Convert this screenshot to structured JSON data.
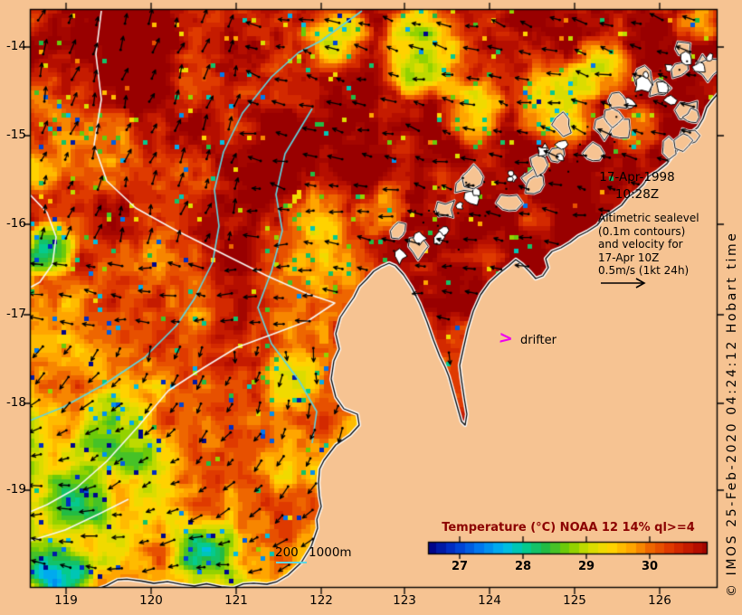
{
  "map": {
    "date_label": "17-Apr-1998",
    "time_label": "10:28Z",
    "annotation_lines": [
      "Altimetric sealevel",
      "(0.1m contours)",
      "and velocity for",
      "17-Apr 10Z",
      "0.5m/s (1kt 24h)"
    ],
    "drifter_symbol": ">",
    "drifter_label": "drifter",
    "depth_legend": "200 1000m",
    "copyright": "© IMOS 25-Feb-2020 04:24:12 Hobart time"
  },
  "axes": {
    "lon_tick_labels": [
      "119",
      "120",
      "121",
      "122",
      "123",
      "124",
      "125",
      "126"
    ],
    "lat_tick_labels": [
      "-14",
      "-15",
      "-16",
      "-17",
      "-18",
      "-19"
    ]
  },
  "colorbar": {
    "title": "Temperature (°C) NOAA 12 14% ql>=4",
    "tick_labels": [
      "27",
      "28",
      "29",
      "30"
    ],
    "value_min": 26.5,
    "value_max": 30.9
  },
  "colors": {
    "land": "#F6C392",
    "coast_halo": "#FFFFFF",
    "coast_line": "#000000",
    "bathymetry_cyan": "#5FD6E2",
    "sealevel_contour_white": "#F8F8F4",
    "vector_black": "#000000",
    "drifter_magenta": "#EE00EE",
    "colorbar_title_red": "#8B0000",
    "deep_sst_red": "#A40000",
    "palette": [
      [
        26.5,
        "#000080"
      ],
      [
        26.9,
        "#0033CC"
      ],
      [
        27.3,
        "#0077EE"
      ],
      [
        27.7,
        "#00BBEE"
      ],
      [
        28.0,
        "#00CC99"
      ],
      [
        28.35,
        "#22BB44"
      ],
      [
        28.7,
        "#77CC00"
      ],
      [
        29.0,
        "#CCDD00"
      ],
      [
        29.35,
        "#FFD900"
      ],
      [
        29.7,
        "#FFA500"
      ],
      [
        30.0,
        "#EE6600"
      ],
      [
        30.35,
        "#DD3300"
      ],
      [
        30.7,
        "#BB1100"
      ],
      [
        31.0,
        "#990000"
      ]
    ]
  },
  "chart_data": {
    "type": "heatmap",
    "title": "Temperature (°C) NOAA 12 14% ql>=4",
    "x_ticks": [
      119,
      120,
      121,
      122,
      123,
      124,
      125,
      126
    ],
    "y_ticks": [
      -14,
      -15,
      -16,
      -17,
      -18,
      -19
    ],
    "colorbar_ticks": [
      27,
      28,
      29,
      30
    ],
    "colorbar_range": [
      26.5,
      30.9
    ],
    "legend_position": "bottom-right",
    "overlays": [
      "sea surface temperature raster",
      "altimetric sealevel contours (0.1m)",
      "velocity vectors",
      "bathymetry contours 200m 1000m",
      "drifter marker"
    ]
  }
}
